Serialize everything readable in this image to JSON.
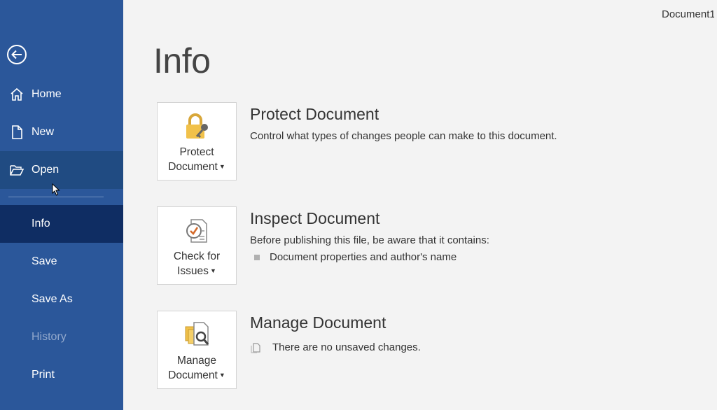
{
  "header": {
    "document_title": "Document1"
  },
  "sidebar": {
    "items": [
      {
        "label": "Home",
        "icon": "home-icon"
      },
      {
        "label": "New",
        "icon": "new-document-icon"
      },
      {
        "label": "Open",
        "icon": "folder-open-icon"
      },
      {
        "label": "Info"
      },
      {
        "label": "Save"
      },
      {
        "label": "Save As"
      },
      {
        "label": "History"
      },
      {
        "label": "Print"
      }
    ]
  },
  "main": {
    "title": "Info",
    "sections": [
      {
        "tile_line1": "Protect",
        "tile_line2": "Document",
        "heading": "Protect Document",
        "description": "Control what types of changes people can make to this document.",
        "icon": "lock-key-icon"
      },
      {
        "tile_line1": "Check for",
        "tile_line2": "Issues",
        "heading": "Inspect Document",
        "description": "Before publishing this file, be aware that it contains:",
        "bullets": [
          "Document properties and author's name"
        ],
        "icon": "inspect-checklist-icon"
      },
      {
        "tile_line1": "Manage",
        "tile_line2": "Document",
        "heading": "Manage Document",
        "status": "There are no unsaved changes.",
        "icon": "manage-document-icon"
      }
    ]
  },
  "colors": {
    "sidebar_bg": "#2b579a",
    "sidebar_active": "#0f2d63",
    "page_bg": "#f3f3f3"
  }
}
